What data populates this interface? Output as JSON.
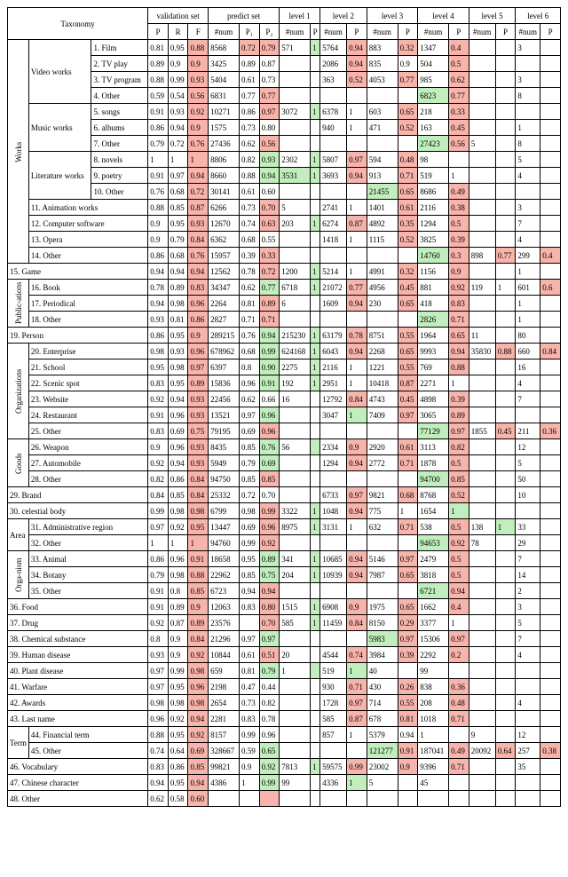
{
  "headers": {
    "taxonomy": "Taxonomy",
    "validation": "validation set",
    "predict": "predict set",
    "level1": "level 1",
    "level2": "level 2",
    "level3": "level 3",
    "level4": "level 4",
    "level5": "level 5",
    "level6": "level 6",
    "P": "P",
    "R": "R",
    "F": "F",
    "num": "#num",
    "P1": "P₁",
    "P2": "P₂"
  },
  "groups": {
    "works": "Works",
    "video": "Video works",
    "music": "Music works",
    "lit": "Literature works",
    "pub": "Public-ations",
    "org": "Organizations",
    "goods": "Goods",
    "area": "Area",
    "organ": "Orga-nism",
    "term": "Term"
  },
  "rows": [
    [
      "1. Film",
      "0.81",
      "0.95",
      "0.88",
      "8568",
      "0.72",
      "0.79",
      "571",
      "1",
      "5764",
      "0.94",
      "883",
      "0.32",
      "1347",
      "0.4",
      "",
      "",
      "3",
      ""
    ],
    [
      "2. TV play",
      "0.89",
      "0.9",
      "0.9",
      "3425",
      "0.89",
      "0.87",
      "",
      "",
      "2086",
      "0.94",
      "835",
      "0.9",
      "504",
      "0.5",
      "",
      "",
      "",
      ""
    ],
    [
      "3. TV program",
      "0.88",
      "0.99",
      "0.93",
      "5404",
      "0.61",
      "0.73",
      "",
      "",
      "363",
      "0.52",
      "4053",
      "0.77",
      "985",
      "0.62",
      "",
      "",
      "3",
      ""
    ],
    [
      "4. Other",
      "0.59",
      "0.54",
      "0.56",
      "6831",
      "0.77",
      "0.77",
      "",
      "",
      "",
      "",
      "",
      "",
      "6823",
      "0.77",
      "",
      "",
      "8",
      ""
    ],
    [
      "5. songs",
      "0.91",
      "0.93",
      "0.92",
      "10271",
      "0.86",
      "0.97",
      "3072",
      "1",
      "6378",
      "1",
      "603",
      "0.65",
      "218",
      "0.33",
      "",
      "",
      "",
      ""
    ],
    [
      "6. albums",
      "0.86",
      "0.94",
      "0.9",
      "1575",
      "0.73",
      "0.80",
      "",
      "",
      "940",
      "1",
      "471",
      "0.52",
      "163",
      "0.45",
      "",
      "",
      "1",
      ""
    ],
    [
      "7. Other",
      "0.79",
      "0.72",
      "0.76",
      "27436",
      "0.62",
      "0.56",
      "",
      "",
      "",
      "",
      "",
      "",
      "27423",
      "0.56",
      "5",
      "",
      "8",
      ""
    ],
    [
      "8. novels",
      "1",
      "1",
      "1",
      "8806",
      "0.82",
      "0.93",
      "2302",
      "1",
      "5807",
      "0.97",
      "594",
      "0.48",
      "98",
      "",
      "",
      "",
      "5",
      ""
    ],
    [
      "9. poetry",
      "0.91",
      "0.97",
      "0.94",
      "8660",
      "0.88",
      "0.94",
      "3531",
      "1",
      "3693",
      "0.94",
      "913",
      "0.71",
      "519",
      "1",
      "",
      "",
      "4",
      ""
    ],
    [
      "10. Other",
      "0.76",
      "0.68",
      "0.72",
      "30141",
      "0.61",
      "0.60",
      "",
      "",
      "",
      "",
      "21455",
      "0.65",
      "8686",
      "0.49",
      "",
      "",
      "",
      ""
    ],
    [
      "11. Animation works",
      "0.88",
      "0.85",
      "0.87",
      "6266",
      "0.73",
      "0.70",
      "5",
      "",
      "2741",
      "1",
      "1401",
      "0.61",
      "2116",
      "0.38",
      "",
      "",
      "3",
      ""
    ],
    [
      "12. Computer software",
      "0.9",
      "0.95",
      "0.93",
      "12670",
      "0.74",
      "0.63",
      "203",
      "1",
      "6274",
      "0.87",
      "4892",
      "0.35",
      "1294",
      "0.5",
      "",
      "",
      "7",
      ""
    ],
    [
      "13. Opera",
      "0.9",
      "0.79",
      "0.84",
      "6362",
      "0.68",
      "0.55",
      "",
      "",
      "1418",
      "1",
      "1115",
      "0.52",
      "3825",
      "0.39",
      "",
      "",
      "4",
      ""
    ],
    [
      "14. Other",
      "0.86",
      "0.68",
      "0.76",
      "15957",
      "0.39",
      "0.33",
      "",
      "",
      "",
      "",
      "",
      "",
      "14760",
      "0.3",
      "898",
      "0.77",
      "299",
      "0.4"
    ],
    [
      "15. Game",
      "0.94",
      "0.94",
      "0.94",
      "12562",
      "0.78",
      "0.72",
      "1200",
      "1",
      "5214",
      "1",
      "4991",
      "0.32",
      "1156",
      "0.9",
      "",
      "",
      "1",
      ""
    ],
    [
      "16. Book",
      "0.78",
      "0.89",
      "0.83",
      "34347",
      "0.62",
      "0.77",
      "6718",
      "1",
      "21072",
      "0.77",
      "4956",
      "0.45",
      "881",
      "0.92",
      "119",
      "1",
      "601",
      "0.6"
    ],
    [
      "17. Periodical",
      "0.94",
      "0.98",
      "0.96",
      "2264",
      "0.81",
      "0.89",
      "6",
      "",
      "1609",
      "0.94",
      "230",
      "0.65",
      "418",
      "0.83",
      "",
      "",
      "1",
      ""
    ],
    [
      "18. Other",
      "0.93",
      "0.81",
      "0.86",
      "2827",
      "0.71",
      "0.71",
      "",
      "",
      "",
      "",
      "",
      "",
      "2826",
      "0.71",
      "",
      "",
      "1",
      ""
    ],
    [
      "19. Person",
      "0.86",
      "0.95",
      "0.9",
      "289215",
      "0.76",
      "0.94",
      "215230",
      "1",
      "63179",
      "0.78",
      "8751",
      "0.55",
      "1964",
      "0.65",
      "11",
      "",
      "80",
      ""
    ],
    [
      "20. Enterprise",
      "0.98",
      "0.93",
      "0.96",
      "678962",
      "0.68",
      "0.99",
      "624168",
      "1",
      "6043",
      "0.94",
      "2268",
      "0.65",
      "9993",
      "0.94",
      "35830",
      "0.88",
      "660",
      "0.84"
    ],
    [
      "21. School",
      "0.95",
      "0.98",
      "0.97",
      "6397",
      "0.8",
      "0.90",
      "2275",
      "1",
      "2116",
      "1",
      "1221",
      "0.55",
      "769",
      "0.88",
      "",
      "",
      "16",
      ""
    ],
    [
      "22. Scenic spot",
      "0.83",
      "0.95",
      "0.89",
      "15836",
      "0.96",
      "0.91",
      "192",
      "1",
      "2951",
      "1",
      "10418",
      "0.87",
      "2271",
      "1",
      "",
      "",
      "4",
      ""
    ],
    [
      "23. Website",
      "0.92",
      "0.94",
      "0.93",
      "22456",
      "0.62",
      "0.66",
      "16",
      "",
      "12792",
      "0.84",
      "4743",
      "0.45",
      "4898",
      "0.39",
      "",
      "",
      "7",
      ""
    ],
    [
      "24. Restaurant",
      "0.91",
      "0.96",
      "0.93",
      "13521",
      "0.97",
      "0.96",
      "",
      "",
      "3047",
      "1",
      "7409",
      "0.97",
      "3065",
      "0.89",
      "",
      "",
      "",
      ""
    ],
    [
      "25. Other",
      "0.83",
      "0.69",
      "0.75",
      "79195",
      "0.69",
      "0.96",
      "",
      "",
      "",
      "",
      "",
      "",
      "77129",
      "0.97",
      "1855",
      "0.45",
      "211",
      "0.36"
    ],
    [
      "26. Weapon",
      "0.9",
      "0.96",
      "0.93",
      "8435",
      "0.85",
      "0.76",
      "56",
      "",
      "2334",
      "0.9",
      "2920",
      "0.61",
      "3113",
      "0.82",
      "",
      "",
      "12",
      ""
    ],
    [
      "27. Automobile",
      "0.92",
      "0.94",
      "0.93",
      "5949",
      "0.79",
      "0.69",
      "",
      "",
      "1294",
      "0.94",
      "2772",
      "0.71",
      "1878",
      "0.5",
      "",
      "",
      "5",
      ""
    ],
    [
      "28. Other",
      "0.82",
      "0.86",
      "0.84",
      "94750",
      "0.85",
      "0.85",
      "",
      "",
      "",
      "",
      "",
      "",
      "94700",
      "0.85",
      "",
      "",
      "50",
      ""
    ],
    [
      "29. Brand",
      "0.84",
      "0.85",
      "0.84",
      "25332",
      "0.72",
      "0.70",
      "",
      "",
      "6733",
      "0.97",
      "9821",
      "0.68",
      "8768",
      "0.52",
      "",
      "",
      "10",
      ""
    ],
    [
      "30. celestial body",
      "0.99",
      "0.98",
      "0.98",
      "6799",
      "0.98",
      "0.99",
      "3322",
      "1",
      "1048",
      "0.94",
      "775",
      "1",
      "1654",
      "1",
      "",
      "",
      "",
      ""
    ],
    [
      "31. Administrative region",
      "0.97",
      "0.92",
      "0.95",
      "13447",
      "0.69",
      "0.96",
      "8975",
      "1",
      "3131",
      "1",
      "632",
      "0.71",
      "538",
      "0.5",
      "138",
      "1",
      "33",
      ""
    ],
    [
      "32. Other",
      "1",
      "1",
      "1",
      "94760",
      "0.99",
      "0.92",
      "",
      "",
      "",
      "",
      "",
      "",
      "94653",
      "0.92",
      "78",
      "",
      "29",
      ""
    ],
    [
      "33. Animal",
      "0.86",
      "0.96",
      "0.91",
      "18658",
      "0.95",
      "0.89",
      "341",
      "1",
      "10685",
      "0.94",
      "5146",
      "0.97",
      "2479",
      "0.5",
      "",
      "",
      "7",
      ""
    ],
    [
      "34. Botany",
      "0.79",
      "0.98",
      "0.88",
      "22962",
      "0.85",
      "0.75",
      "204",
      "1",
      "10939",
      "0.94",
      "7987",
      "0.65",
      "3818",
      "0.5",
      "",
      "",
      "14",
      ""
    ],
    [
      "35. Other",
      "0.91",
      "0.8",
      "0.85",
      "6723",
      "0.94",
      "0.94",
      "",
      "",
      "",
      "",
      "",
      "",
      "6721",
      "0.94",
      "",
      "",
      "2",
      ""
    ],
    [
      "36. Food",
      "0.91",
      "0.89",
      "0.9",
      "12063",
      "0.83",
      "0.80",
      "1515",
      "1",
      "6908",
      "0.9",
      "1975",
      "0.65",
      "1662",
      "0.4",
      "",
      "",
      "3",
      ""
    ],
    [
      "37. Drug",
      "0.92",
      "0.87",
      "0.89",
      "23576",
      "",
      "0.70",
      "585",
      "1",
      "11459",
      "0.84",
      "8150",
      "0.29",
      "3377",
      "1",
      "",
      "",
      "5",
      ""
    ],
    [
      "38. Chemical substance",
      "0.8",
      "0.9",
      "0.84",
      "21296",
      "0.97",
      "0.97",
      "",
      "",
      "",
      "",
      "5983",
      "0.97",
      "15306",
      "0.97",
      "",
      "",
      "7",
      ""
    ],
    [
      "39. Human disease",
      "0.93",
      "0.9",
      "0.92",
      "10844",
      "0.61",
      "0.51",
      "20",
      "",
      "4544",
      "0.74",
      "3984",
      "0.39",
      "2292",
      "0.2",
      "",
      "",
      "4",
      ""
    ],
    [
      "40. Plant disease",
      "0.97",
      "0.99",
      "0.98",
      "659",
      "0.81",
      "0.79",
      "1",
      "",
      "519",
      "1",
      "40",
      "",
      "99",
      "",
      "",
      "",
      "",
      ""
    ],
    [
      "41. Warfare",
      "0.97",
      "0.95",
      "0.96",
      "2198",
      "0.47",
      "0.44",
      "",
      "",
      "930",
      "0.71",
      "430",
      "0.26",
      "838",
      "0.36",
      "",
      "",
      "",
      ""
    ],
    [
      "42. Awards",
      "0.98",
      "0.98",
      "0.98",
      "2654",
      "0.73",
      "0.82",
      "",
      "",
      "1728",
      "0.97",
      "714",
      "0.55",
      "208",
      "0.48",
      "",
      "",
      "4",
      ""
    ],
    [
      "43. Last name",
      "0.96",
      "0.92",
      "0.94",
      "2281",
      "0.83",
      "0.78",
      "",
      "",
      "585",
      "0.87",
      "678",
      "0.81",
      "1018",
      "0.71",
      "",
      "",
      "",
      ""
    ],
    [
      "44. Financial term",
      "0.88",
      "0.95",
      "0.92",
      "8157",
      "0.99",
      "0.96",
      "",
      "",
      "857",
      "1",
      "5379",
      "0.94",
      "1",
      "",
      "9",
      "",
      "12",
      ""
    ],
    [
      "45. Other",
      "0.74",
      "0.64",
      "0.69",
      "328667",
      "0.59",
      "0.65",
      "",
      "",
      "",
      "",
      "121277",
      "0.91",
      "187041",
      "0.49",
      "20092",
      "0.64",
      "257",
      "0.38"
    ],
    [
      "46. Vocabulary",
      "0.83",
      "0.86",
      "0.85",
      "99821",
      "0.9",
      "0.92",
      "7813",
      "1",
      "59575",
      "0.99",
      "23002",
      "0.9",
      "9396",
      "0.71",
      "",
      "",
      "35",
      ""
    ],
    [
      "47. Chinese character",
      "0.94",
      "0.95",
      "0.94",
      "4386",
      "1",
      "0.99",
      "99",
      "",
      "4336",
      "1",
      "5",
      "",
      "45",
      "",
      "",
      "",
      "",
      ""
    ],
    [
      "48. Other",
      "0.62",
      "0.58",
      "0.60",
      "",
      "",
      "",
      "",
      "",
      "",
      "",
      "",
      "",
      "",
      "",
      "",
      "",
      "",
      ""
    ]
  ]
}
